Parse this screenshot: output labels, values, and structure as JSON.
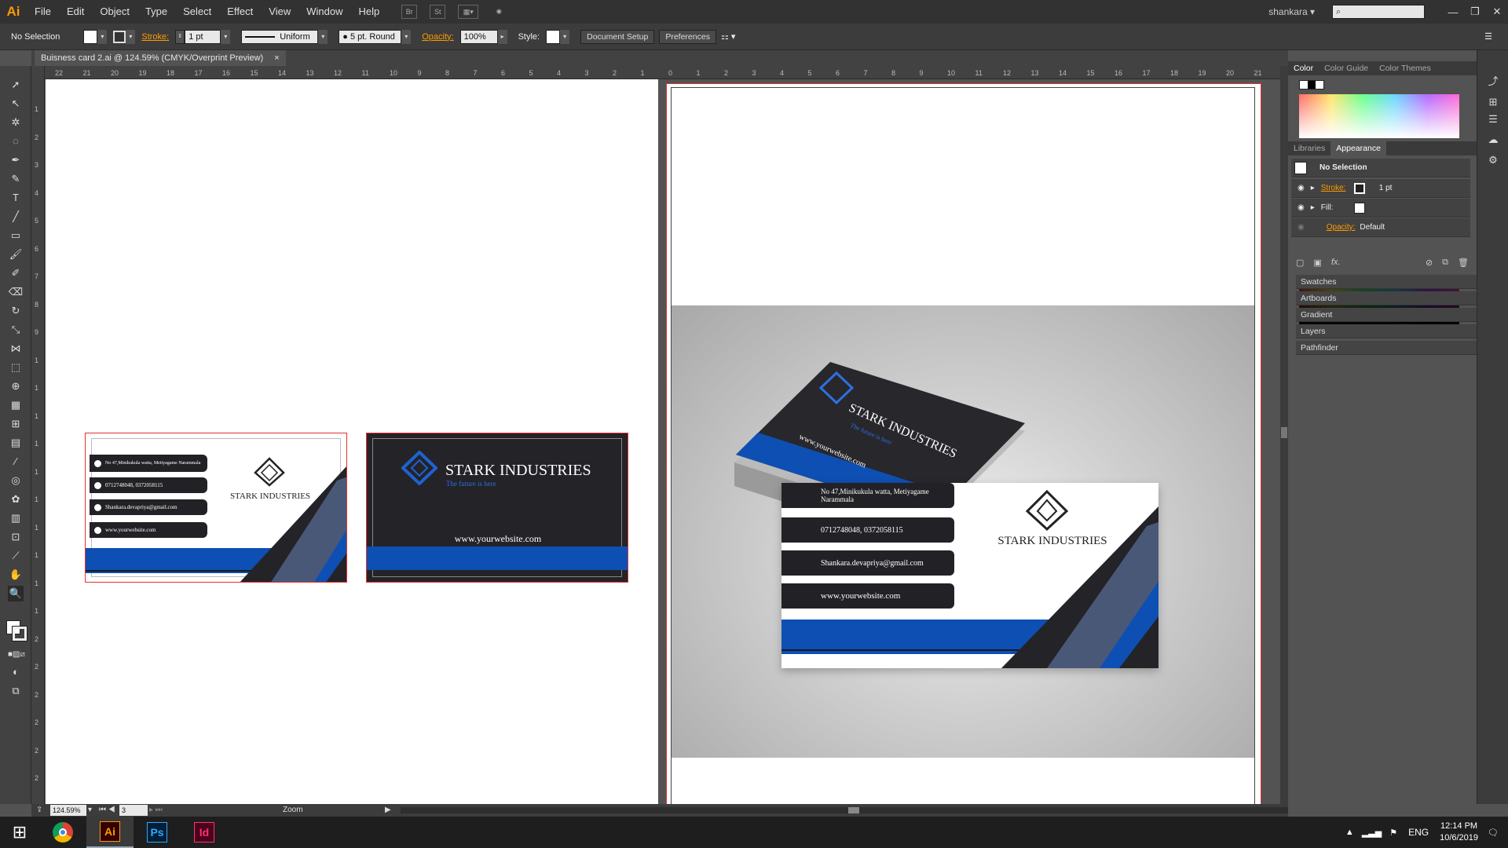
{
  "app": {
    "logo": "Ai"
  },
  "menu": [
    "File",
    "Edit",
    "Object",
    "Type",
    "Select",
    "Effect",
    "View",
    "Window",
    "Help"
  ],
  "menubar_icons": {
    "bridge": "Br",
    "stock": "St"
  },
  "user": {
    "name": "shankara",
    "menu_arrow": "▾"
  },
  "control": {
    "selection": "No Selection",
    "stroke_label": "Stroke:",
    "stroke_value": "1 pt",
    "profile": "Uniform",
    "brush": "5 pt. Round",
    "opacity_label": "Opacity:",
    "opacity_value": "100%",
    "style_label": "Style:",
    "document_setup": "Document Setup",
    "preferences": "Preferences"
  },
  "document_tab": {
    "title": "Buisness card 2.ai @ 124.59% (CMYK/Overprint Preview)",
    "close": "×"
  },
  "ruler_h": [
    "22",
    "21",
    "20",
    "19",
    "18",
    "17",
    "16",
    "15",
    "14",
    "13",
    "12",
    "11",
    "10",
    "9",
    "8",
    "7",
    "6",
    "5",
    "4",
    "3",
    "2",
    "1",
    "0",
    "1",
    "2",
    "3",
    "4",
    "5",
    "6",
    "7",
    "8",
    "9",
    "10",
    "11",
    "12",
    "13",
    "14",
    "15",
    "16",
    "17",
    "18",
    "19",
    "20",
    "21"
  ],
  "ruler_v": [
    "1",
    "2",
    "3",
    "4",
    "5",
    "6",
    "7",
    "8",
    "9",
    "1",
    "1",
    "1",
    "1",
    "1",
    "1",
    "1",
    "1",
    "1",
    "1",
    "2",
    "2",
    "2",
    "2",
    "2",
    "2"
  ],
  "card_front": {
    "address": "No 47,Minikukula watta, Metiyagame Narammala",
    "phone": "0712748048, 0372058115",
    "email": "Shankara.devapriya@gmail.com",
    "website": "www.yourwebsite.com",
    "company": "STARK INDUSTRIES"
  },
  "card_back": {
    "company": "STARK INDUSTRIES",
    "tagline": "The future is here",
    "website": "www.yourwebsite.com"
  },
  "panels": {
    "color_tabs": [
      "Color",
      "Color Guide",
      "Color Themes"
    ],
    "appearance_tabs": [
      "Libraries",
      "Appearance"
    ],
    "appearance": {
      "title": "No Selection",
      "stroke_label": "Stroke:",
      "stroke_value": "1 pt",
      "fill_label": "Fill:",
      "opacity_label": "Opacity:",
      "opacity_value": "Default",
      "fx": "fx."
    },
    "collapsed": [
      "Swatches",
      "Artboards",
      "Gradient",
      "Layers",
      "Pathfinder"
    ]
  },
  "status": {
    "zoom": "124.59%",
    "artboard": "3",
    "tool": "Zoom"
  },
  "taskbar": {
    "apps": [
      "Ai",
      "Ps",
      "Id"
    ],
    "lang": "ENG",
    "time": "12:14 PM",
    "date": "10/6/2019"
  },
  "colors": {
    "accent": "#ff9a00",
    "card_blue": "#0e4fb3",
    "card_dark": "#232328"
  }
}
